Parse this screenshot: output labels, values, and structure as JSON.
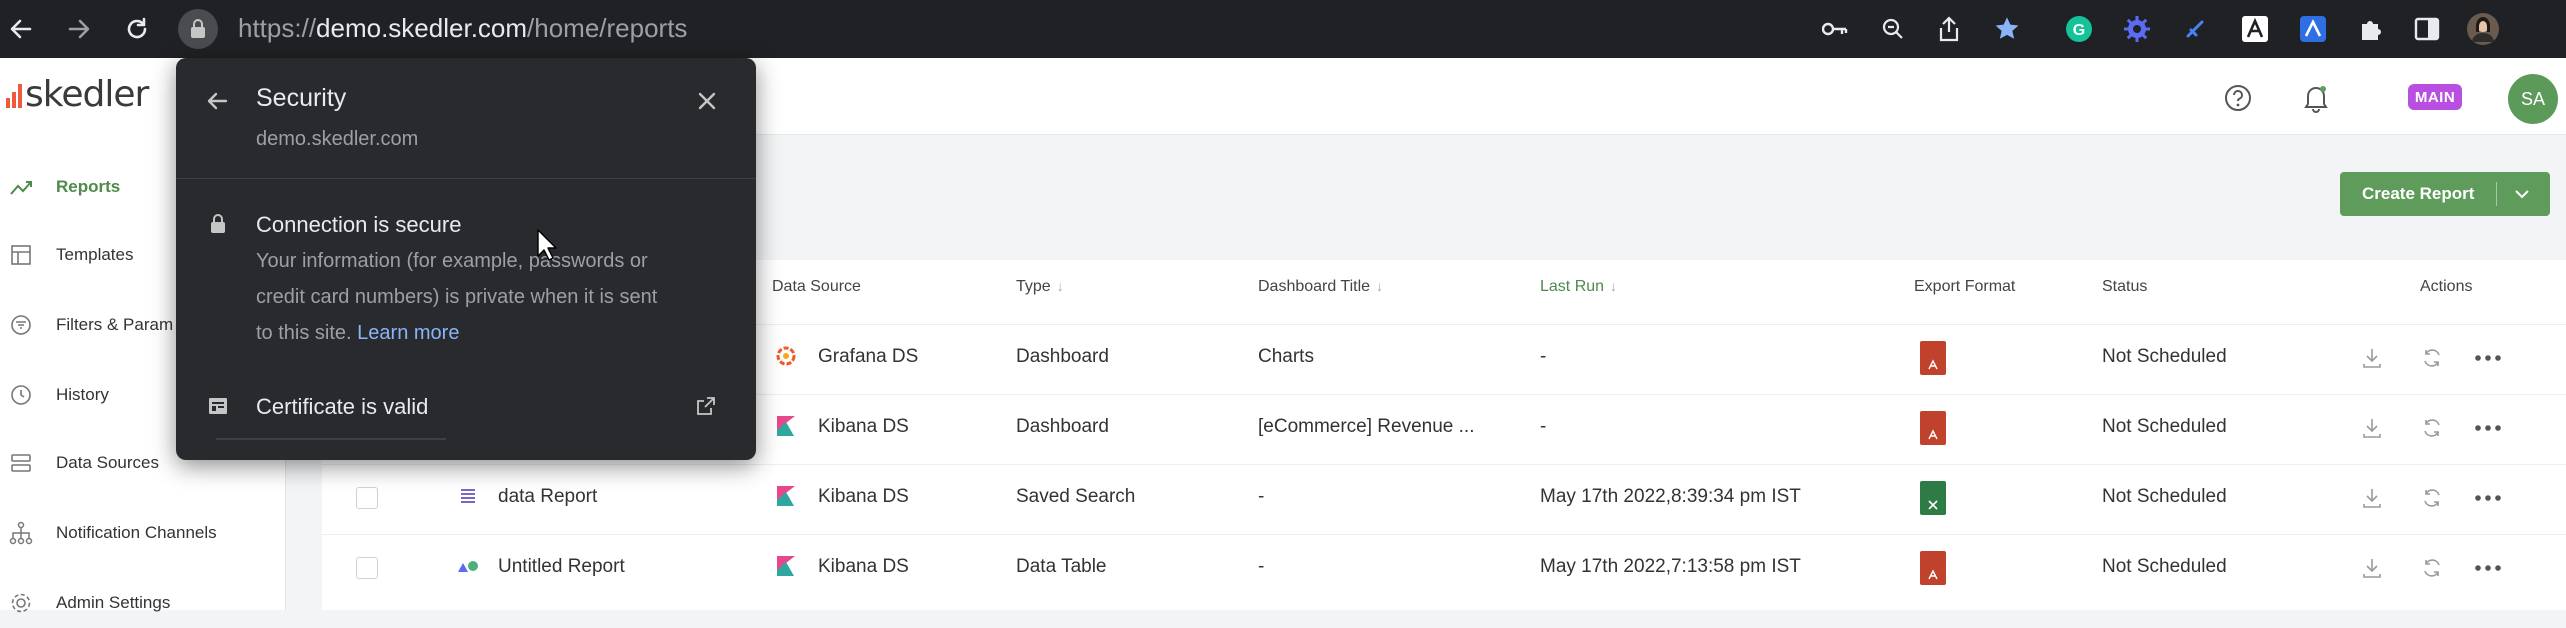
{
  "browser": {
    "url_scheme": "https://",
    "url_host": "demo.skedler.com",
    "url_path": "/home/reports"
  },
  "app": {
    "logo_text": "skedler",
    "workspace_badge": "MAIN",
    "avatar_initials": "SA"
  },
  "sidebar": {
    "items": [
      {
        "label": "Reports",
        "icon": "trend-icon",
        "active": true
      },
      {
        "label": "Templates",
        "icon": "template-icon",
        "active": false
      },
      {
        "label": "Filters & Param",
        "icon": "filter-icon",
        "active": false
      },
      {
        "label": "History",
        "icon": "history-icon",
        "active": false
      },
      {
        "label": "Data Sources",
        "icon": "database-icon",
        "active": false
      },
      {
        "label": "Notification Channels",
        "icon": "channels-icon",
        "active": false
      },
      {
        "label": "Admin Settings",
        "icon": "settings-icon",
        "active": false
      }
    ]
  },
  "toolbar_main": {
    "create_report_label": "Create Report"
  },
  "table": {
    "columns": {
      "data_source": "Data Source",
      "type": "Type",
      "dashboard_title": "Dashboard Title",
      "last_run": "Last Run",
      "export_format": "Export Format",
      "status": "Status",
      "actions": "Actions"
    },
    "rows": [
      {
        "name": "",
        "data_source": "Grafana DS",
        "type": "Dashboard",
        "dashboard_title": "Charts",
        "last_run": "-",
        "export_format": "pdf",
        "status": "Not Scheduled"
      },
      {
        "name": "",
        "data_source": "Kibana DS",
        "type": "Dashboard",
        "dashboard_title": "[eCommerce] Revenue ...",
        "last_run": "-",
        "export_format": "pdf",
        "status": "Not Scheduled"
      },
      {
        "name": "data Report",
        "data_source": "Kibana DS",
        "type": "Saved Search",
        "dashboard_title": "-",
        "last_run": "May 17th 2022,8:39:34 pm IST",
        "export_format": "xls",
        "status": "Not Scheduled"
      },
      {
        "name": "Untitled Report",
        "data_source": "Kibana DS",
        "type": "Data Table",
        "dashboard_title": "-",
        "last_run": "May 17th 2022,7:13:58 pm IST",
        "export_format": "pdf",
        "status": "Not Scheduled"
      }
    ]
  },
  "security_popup": {
    "title": "Security",
    "domain": "demo.skedler.com",
    "connection_title": "Connection is secure",
    "connection_line1": "Your information (for example, passwords or",
    "connection_line2": "credit card numbers) is private when it is sent",
    "connection_line3": "to this site.",
    "learn_more": "Learn more",
    "certificate_label": "Certificate is valid"
  },
  "colors": {
    "brand_green": "#5f9c5b",
    "active_green": "#4f8a4b",
    "browser_dark": "#202124",
    "popup_bg": "#292a2d",
    "link_blue": "#8ab4f8"
  }
}
